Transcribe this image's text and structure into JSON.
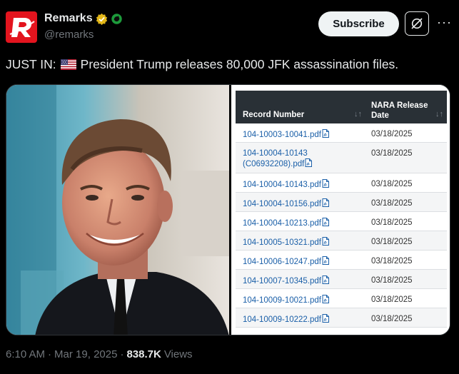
{
  "author": {
    "display_name": "Remarks",
    "handle": "@remarks",
    "avatar_icon": "remarks-r-logo",
    "brand_color": "#e3141e"
  },
  "header": {
    "subscribe_label": "Subscribe",
    "grok_icon": "grok-icon",
    "more_label": "···"
  },
  "tweet": {
    "prefix": "JUST IN:",
    "flag_icon": "us-flag-icon",
    "body": "President Trump releases 80,000 JFK assassination files."
  },
  "document": {
    "col_record": "Record Number",
    "col_date_line1": "NARA Release",
    "col_date_line2": "Date",
    "sort_glyph": "↓↑",
    "rows": [
      {
        "record": "104-10003-10041.pdf",
        "date": "03/18/2025"
      },
      {
        "record": "104-10004-10143 (C06932208).pdf",
        "date": "03/18/2025"
      },
      {
        "record": "104-10004-10143.pdf",
        "date": "03/18/2025"
      },
      {
        "record": "104-10004-10156.pdf",
        "date": "03/18/2025"
      },
      {
        "record": "104-10004-10213.pdf",
        "date": "03/18/2025"
      },
      {
        "record": "104-10005-10321.pdf",
        "date": "03/18/2025"
      },
      {
        "record": "104-10006-10247.pdf",
        "date": "03/18/2025"
      },
      {
        "record": "104-10007-10345.pdf",
        "date": "03/18/2025"
      },
      {
        "record": "104-10009-10021.pdf",
        "date": "03/18/2025"
      },
      {
        "record": "104-10009-10222.pdf",
        "date": "03/18/2025"
      }
    ]
  },
  "footer": {
    "time": "6:10 AM",
    "sep1": "·",
    "date": "Mar 19, 2025",
    "sep2": "·",
    "views_count": "838.7K",
    "views_label": "Views"
  }
}
